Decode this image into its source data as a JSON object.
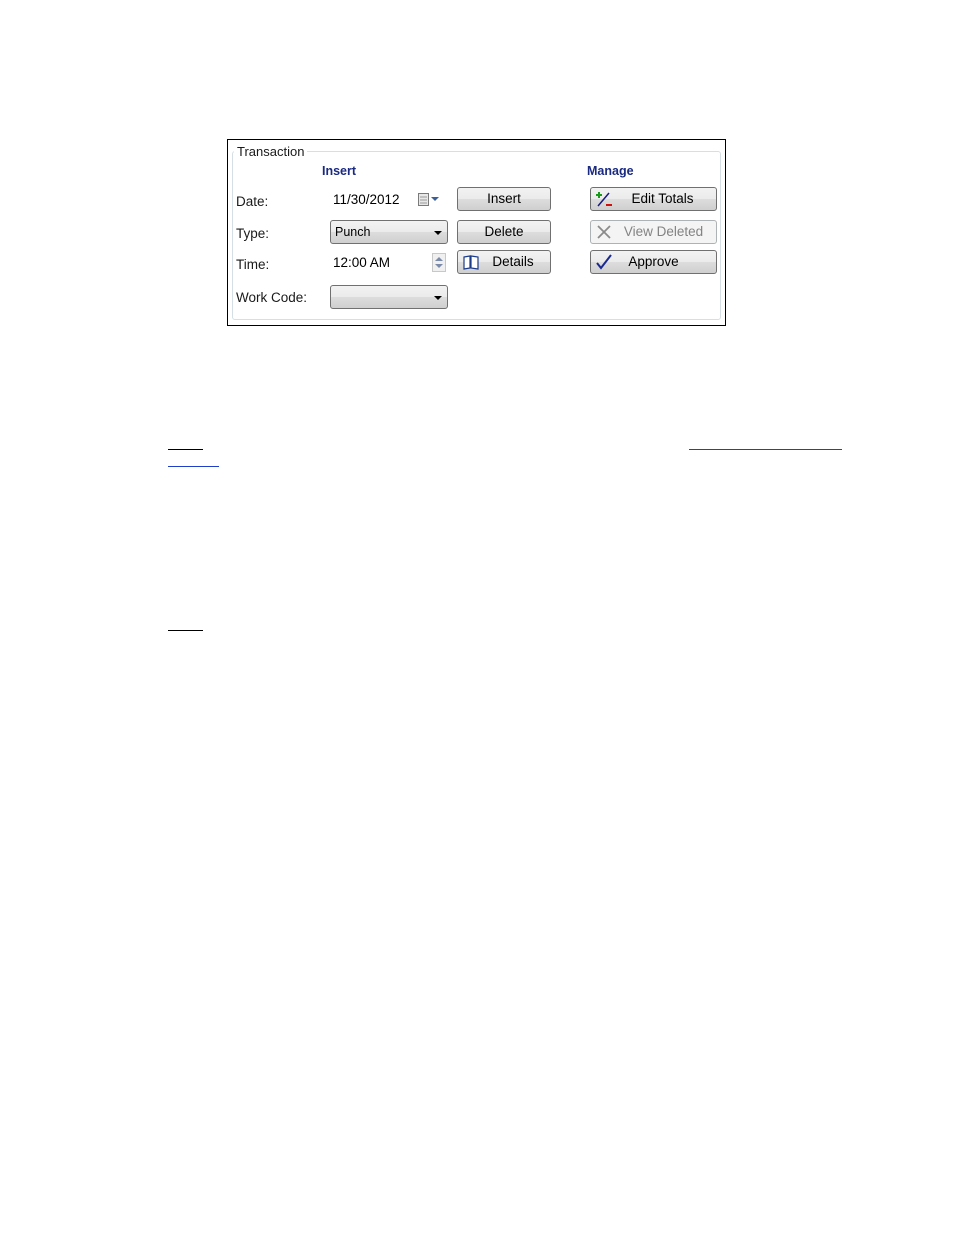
{
  "transaction": {
    "group_title": "Transaction",
    "insert_header": "Insert",
    "manage_header": "Manage",
    "labels": {
      "date": "Date:",
      "type": "Type:",
      "time": "Time:",
      "work_code": "Work Code:"
    },
    "date_value": "11/30/2012",
    "type_value": "Punch",
    "time_value": "12:00 AM",
    "work_code_value": "",
    "buttons": {
      "insert": "Insert",
      "delete": "Delete",
      "details": "Details",
      "edit_totals": "Edit Totals",
      "view_deleted": "View Deleted",
      "approve": "Approve"
    }
  },
  "icons": [
    "calendar-icon",
    "spin-icon",
    "book-icon",
    "plus-minus-icon",
    "x-icon",
    "checkmark-icon"
  ]
}
